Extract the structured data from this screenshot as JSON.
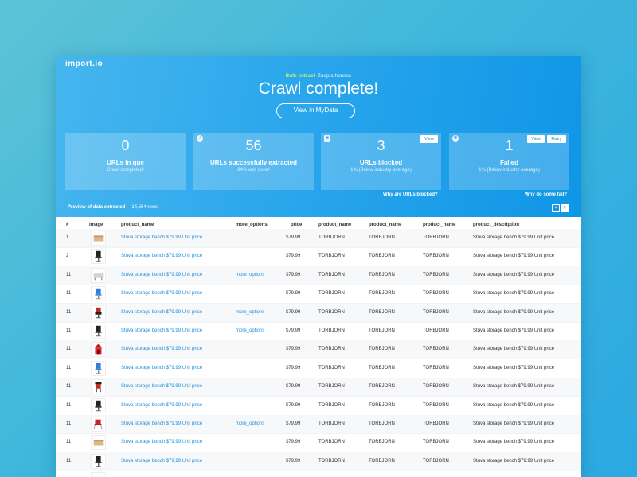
{
  "brand": {
    "logo": "import.io"
  },
  "hero": {
    "subtitle_highlight": "Bulk extract",
    "subtitle_rest": "Zoopla houses",
    "title": "Crawl complete!",
    "view_button": "View in MyData"
  },
  "cards": [
    {
      "value": "0",
      "label": "URLs in que",
      "sub": "Crawl completed!",
      "buttons": []
    },
    {
      "value": "56",
      "label": "URLs successfully extracted",
      "sub": "94% well done!",
      "buttons": []
    },
    {
      "value": "3",
      "label": "URLs blocked",
      "sub": "1% (Below industry average)",
      "buttons": [
        "View"
      ]
    },
    {
      "value": "1",
      "label": "Failed",
      "sub": "1% (Below industry average)",
      "buttons": [
        "View",
        "Retry"
      ]
    }
  ],
  "links": {
    "why_blocked": "Why are URLs blocked?",
    "why_failed": "Why do some fail?"
  },
  "preview": {
    "label": "Preview of data extracted",
    "rows": "14,564 rows"
  },
  "pager": {
    "prev": "<",
    "next": ">"
  },
  "table": {
    "headers": [
      "#",
      "image",
      "product_name",
      "more_options",
      "price",
      "product_name",
      "product_name",
      "product_name",
      "product_description"
    ],
    "rows": [
      {
        "num": "1",
        "image": "box-bench",
        "name": "Stuva storage bench $79.99 Unit price",
        "more": "",
        "price": "$79.99",
        "p1": "TORBJORN",
        "p2": "TORBJORN",
        "p3": "TORBJORN",
        "desc": "Stuva storage bench $79.99 Unit price"
      },
      {
        "num": "2",
        "image": "black-chair",
        "name": "Stuva storage bench $79.99 Unit price",
        "more": "",
        "price": "$79.99",
        "p1": "TORBJORN",
        "p2": "TORBJORN",
        "p3": "TORBJORN",
        "desc": "Stuva storage bench $79.99 Unit price"
      },
      {
        "num": "11",
        "image": "grey-bench",
        "name": "Stuva storage bench $79.99 Unit price",
        "more": "more_options",
        "price": "$79.99",
        "p1": "TORBJORN",
        "p2": "TORBJORN",
        "p3": "TORBJORN",
        "desc": "Stuva storage bench $79.99 Unit price"
      },
      {
        "num": "11",
        "image": "blue-chair",
        "name": "Stuva storage bench $79.99 Unit price",
        "more": "",
        "price": "$79.99",
        "p1": "TORBJORN",
        "p2": "TORBJORN",
        "p3": "TORBJORN",
        "desc": "Stuva storage bench $79.99 Unit price"
      },
      {
        "num": "11",
        "image": "red-chair",
        "name": "Stuva storage bench $79.99 Unit price",
        "more": "more_options",
        "price": "$79.99",
        "p1": "TORBJORN",
        "p2": "TORBJORN",
        "p3": "TORBJORN",
        "desc": "Stuva storage bench $79.99 Unit price"
      },
      {
        "num": "11",
        "image": "black-chair",
        "name": "Stuva storage bench $79.99 Unit price",
        "more": "more_options",
        "price": "$79.99",
        "p1": "TORBJORN",
        "p2": "TORBJORN",
        "p3": "TORBJORN",
        "desc": "Stuva storage bench $79.99 Unit price"
      },
      {
        "num": "11",
        "image": "red-cabinet",
        "name": "Stuva storage bench $79.99 Unit price",
        "more": "",
        "price": "$79.99",
        "p1": "TORBJORN",
        "p2": "TORBJORN",
        "p3": "TORBJORN",
        "desc": "Stuva storage bench $79.99 Unit price"
      },
      {
        "num": "11",
        "image": "blue-chair",
        "name": "Stuva storage bench $79.99 Unit price",
        "more": "",
        "price": "$79.99",
        "p1": "TORBJORN",
        "p2": "TORBJORN",
        "p3": "TORBJORN",
        "desc": "Stuva storage bench $79.99 Unit price"
      },
      {
        "num": "11",
        "image": "black-stool",
        "name": "Stuva storage bench $79.99 Unit price",
        "more": "",
        "price": "$79.99",
        "p1": "TORBJORN",
        "p2": "TORBJORN",
        "p3": "TORBJORN",
        "desc": "Stuva storage bench $79.99 Unit price"
      },
      {
        "num": "11",
        "image": "black-chair",
        "name": "Stuva storage bench $79.99 Unit price",
        "more": "",
        "price": "$79.99",
        "p1": "TORBJORN",
        "p2": "TORBJORN",
        "p3": "TORBJORN",
        "desc": "Stuva storage bench $79.99 Unit price"
      },
      {
        "num": "11",
        "image": "red-highchair",
        "name": "Stuva storage bench $79.99 Unit price",
        "more": "more_options",
        "price": "$79.99",
        "p1": "TORBJORN",
        "p2": "TORBJORN",
        "p3": "TORBJORN",
        "desc": "Stuva storage bench $79.99 Unit price"
      },
      {
        "num": "11",
        "image": "box-bench",
        "name": "Stuva storage bench $79.99 Unit price",
        "more": "",
        "price": "$79.99",
        "p1": "TORBJORN",
        "p2": "TORBJORN",
        "p3": "TORBJORN",
        "desc": "Stuva storage bench $79.99 Unit price"
      },
      {
        "num": "11",
        "image": "black-chair",
        "name": "Stuva storage bench $79.99 Unit price",
        "more": "",
        "price": "$79.99",
        "p1": "TORBJORN",
        "p2": "TORBJORN",
        "p3": "TORBJORN",
        "desc": "Stuva storage bench $79.99 Unit price"
      },
      {
        "num": "11",
        "image": "grey-bench",
        "name": "Stuva storage bench $79.99 Unit price",
        "more": "",
        "price": "$79.99",
        "p1": "TORBJORN",
        "p2": "TORBJORN",
        "p3": "TORBJORN",
        "desc": "Stuva storage bench $79.99 Unit price"
      }
    ]
  },
  "colors": {
    "accent": "#1e8fdc",
    "hero_start": "#45b6ee",
    "hero_end": "#0f96e6",
    "highlight": "#b8f276"
  }
}
